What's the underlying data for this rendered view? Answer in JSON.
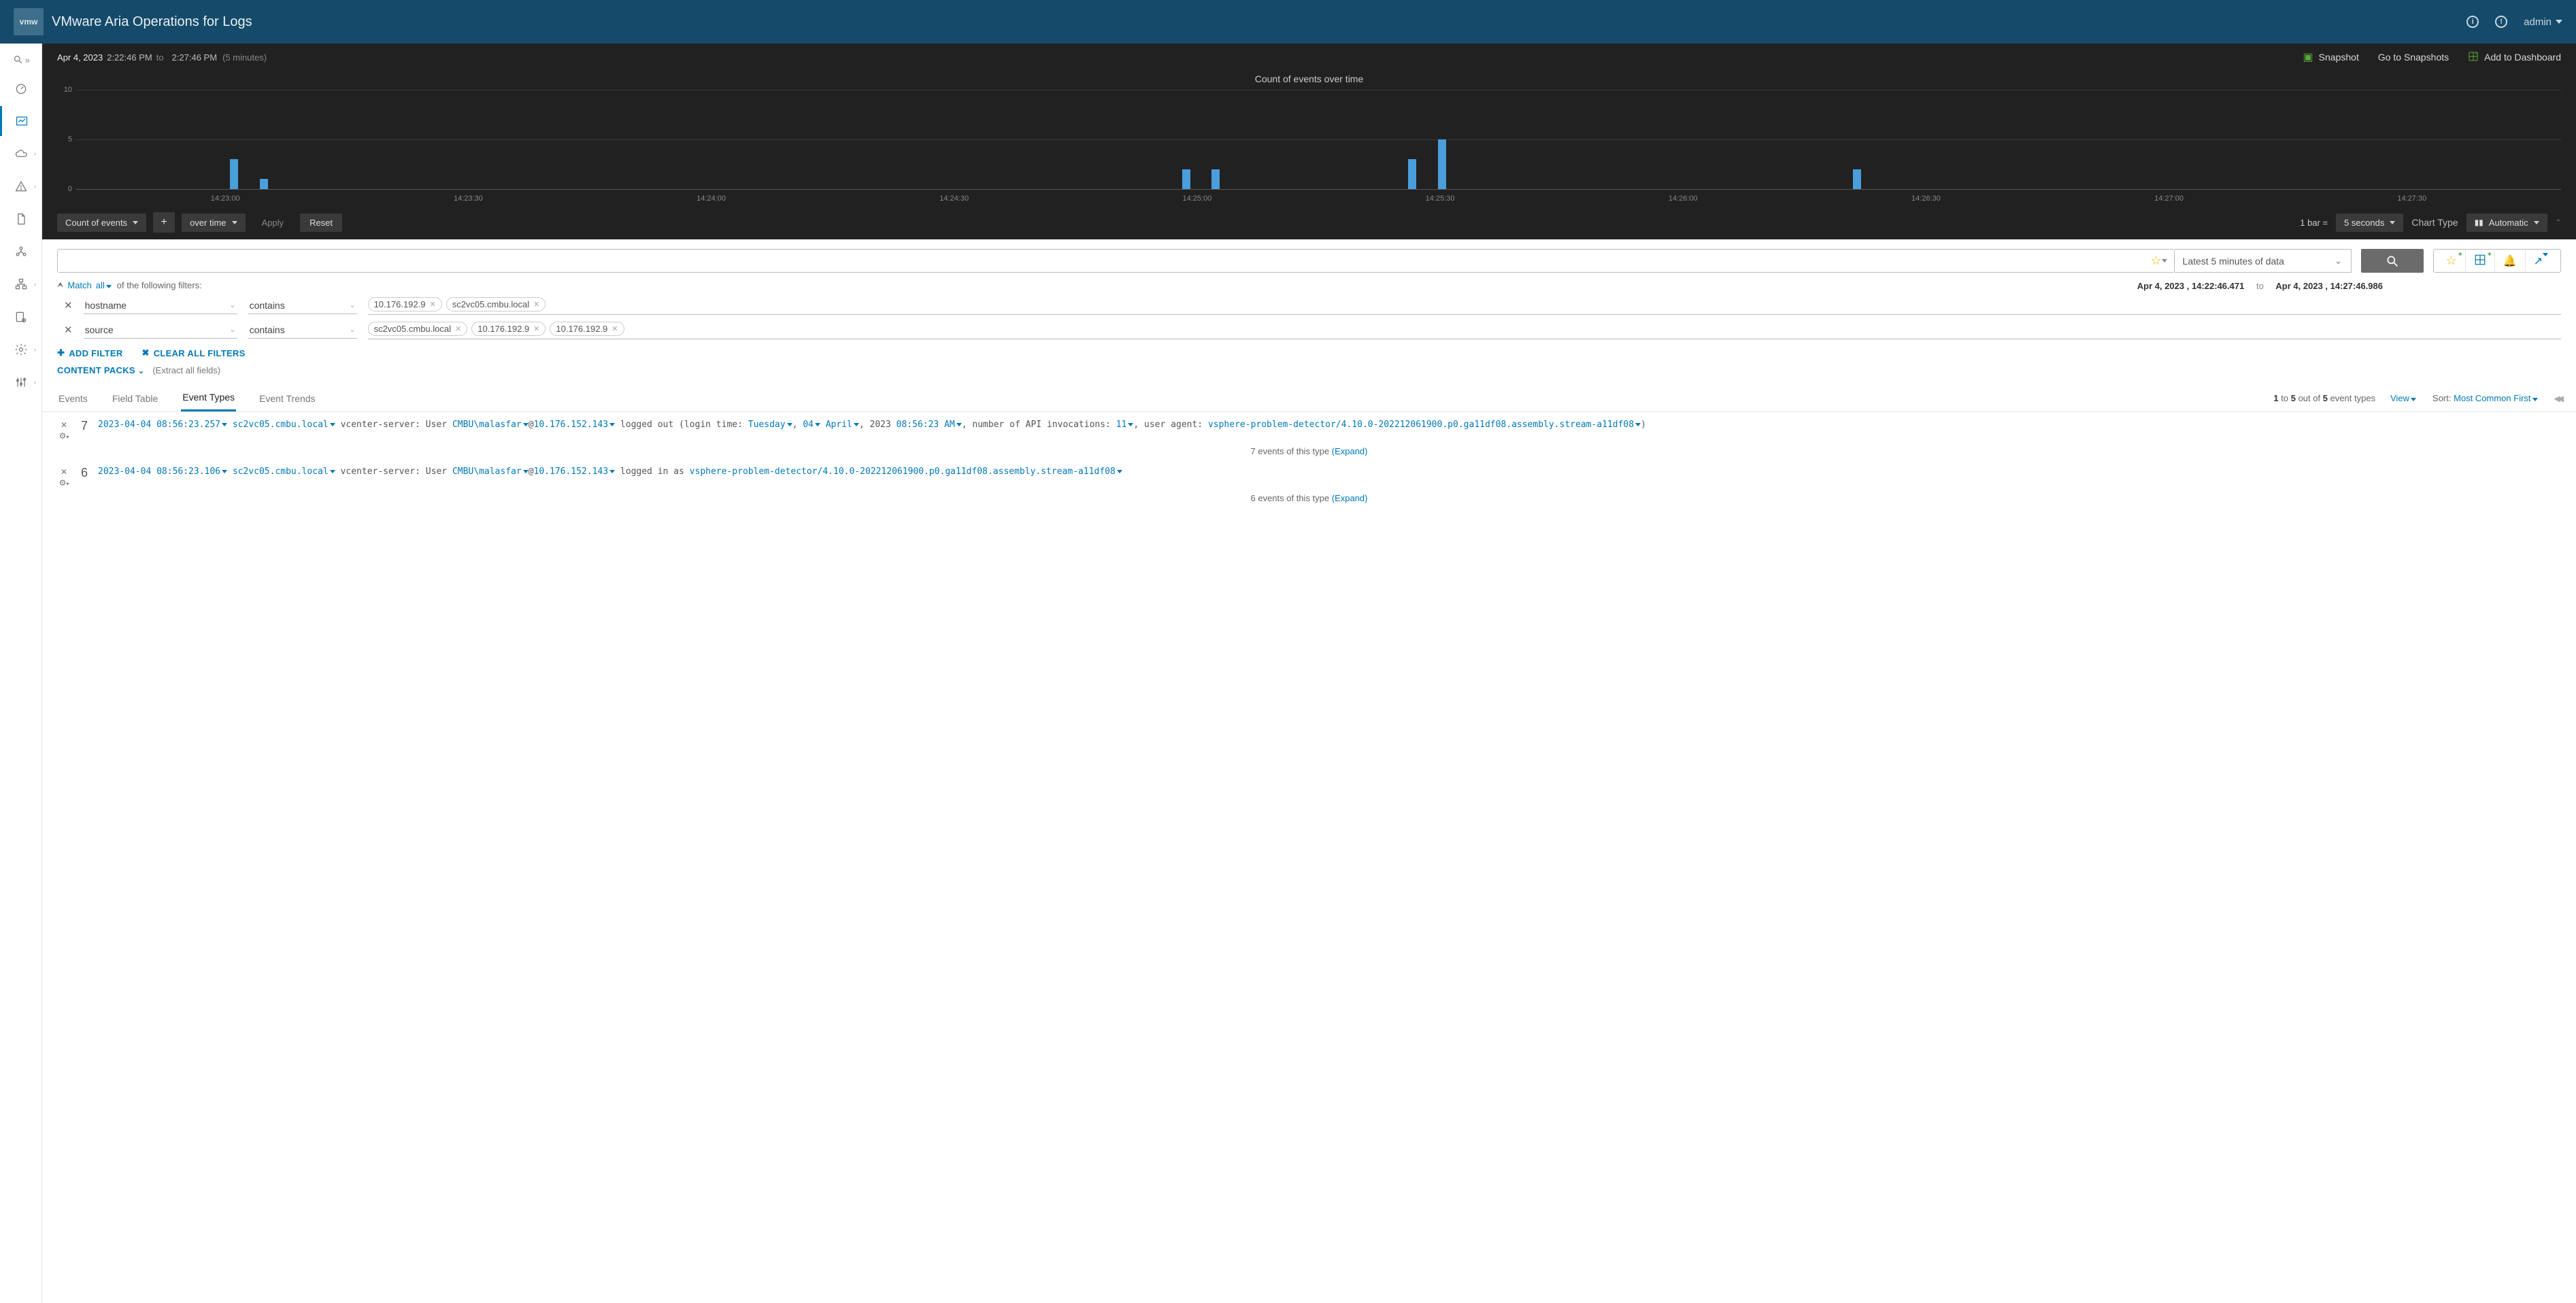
{
  "header": {
    "product_title": "VMware Aria Operations for Logs",
    "logo_text": "vmw",
    "user_label": "admin"
  },
  "toolbar": {
    "date": "Apr 4, 2023",
    "time_from": "2:22:46 PM",
    "to_label": "to",
    "time_to": "2:27:46 PM",
    "duration": "(5 minutes)",
    "snapshot_label": "Snapshot",
    "goto_snapshots_label": "Go to Snapshots",
    "add_dashboard_label": "Add to Dashboard"
  },
  "chart_data": {
    "type": "bar",
    "title": "Count of events over time",
    "ylabel": "",
    "xlabel": "",
    "ylim": [
      0,
      10
    ],
    "y_ticks": [
      0,
      5,
      10
    ],
    "x_ticks": [
      "14:23:00",
      "14:23:30",
      "14:24:00",
      "14:24:30",
      "14:25:00",
      "14:25:30",
      "14:26:00",
      "14:26:30",
      "14:27:00",
      "14:27:30"
    ],
    "bars": [
      {
        "x_pct": 6.2,
        "value": 3
      },
      {
        "x_pct": 7.4,
        "value": 1
      },
      {
        "x_pct": 44.5,
        "value": 2
      },
      {
        "x_pct": 45.7,
        "value": 2
      },
      {
        "x_pct": 53.6,
        "value": 3
      },
      {
        "x_pct": 54.8,
        "value": 5
      },
      {
        "x_pct": 71.5,
        "value": 2
      }
    ]
  },
  "controls": {
    "count_label": "Count of events",
    "overtime_label": "over time",
    "apply_label": "Apply",
    "reset_label": "Reset",
    "bar_eq_label": "1 bar =",
    "bar_size": "5 seconds",
    "chart_type_label": "Chart Type",
    "chart_type_value": "Automatic"
  },
  "search": {
    "placeholder": "",
    "time_range_label": "Latest 5 minutes of data"
  },
  "range": {
    "from_date": "Apr 4, 2023 ,",
    "from_time": "14:22:46.471",
    "to_label": "to",
    "to_date": "Apr 4, 2023 ,",
    "to_time": "14:27:46.986"
  },
  "filters": {
    "match_prefix": "Match",
    "match_mode": "all",
    "match_suffix": "of the following filters:",
    "rows": [
      {
        "field": "hostname",
        "op": "contains",
        "values": [
          "10.176.192.9",
          "sc2vc05.cmbu.local"
        ]
      },
      {
        "field": "source",
        "op": "contains",
        "values": [
          "sc2vc05.cmbu.local",
          "10.176.192.9",
          "10.176.192.9"
        ]
      }
    ],
    "add_filter_label": "ADD FILTER",
    "clear_all_label": "CLEAR ALL FILTERS",
    "content_packs_label": "CONTENT PACKS",
    "extract_note": "(Extract all fields)"
  },
  "tabs": {
    "events": "Events",
    "field_table": "Field Table",
    "event_types": "Event Types",
    "event_trends": "Event Trends",
    "paging_a": "1",
    "paging_b": "5",
    "paging_c": "5",
    "paging_tail": "event types",
    "view_label": "View",
    "sort_label": "Sort:",
    "sort_value": "Most Common First"
  },
  "events": [
    {
      "count": "7",
      "ts": "2023-04-04 08:56:23.257",
      "host": "sc2vc05.cmbu.local",
      "svc": "vcenter-server: User",
      "user": "CMBU\\malasfar",
      "at": "@",
      "ip": "10.176.152.143",
      "tail1": "logged out (login time:",
      "day": "Tuesday",
      "comma1": ",",
      "dom": "04",
      "month": "April",
      "comma2": ", 2023",
      "time2": "08:56:23 AM",
      "tail2": ", number of API invocations:",
      "num": "11",
      "tail3": ", user agent:",
      "agent": "vsphere-problem-detector/4.10.0-202212061900.p0.ga11df08.assembly.stream-a11df08",
      "tail4": ")",
      "summary_pre": "7 events of this type",
      "expand": "(Expand)"
    },
    {
      "count": "6",
      "ts": "2023-04-04 08:56:23.106",
      "host": "sc2vc05.cmbu.local",
      "svc": "vcenter-server: User",
      "user": "CMBU\\malasfar",
      "at": "@",
      "ip": "10.176.152.143",
      "tail1": "logged in as",
      "agent": "vsphere-problem-detector/4.10.0-202212061900.p0.ga11df08.assembly.stream-a11df08",
      "summary_pre": "6 events of this type",
      "expand": "(Expand)"
    }
  ]
}
